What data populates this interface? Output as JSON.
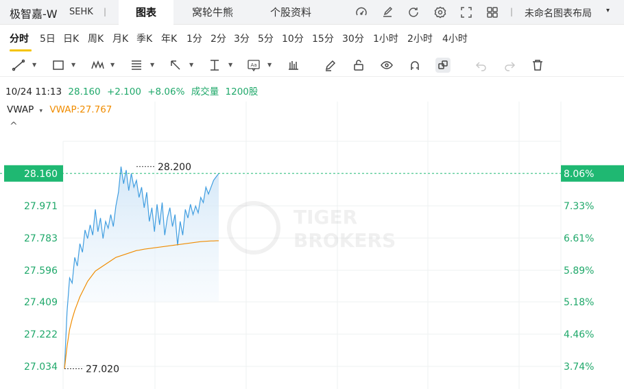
{
  "header": {
    "stock_name": "极智嘉-W",
    "exchange": "SEHK",
    "separator": "|",
    "tabs": [
      {
        "label": "图表",
        "active": true
      },
      {
        "label": "窝轮牛熊",
        "active": false
      },
      {
        "label": "个股资料",
        "active": false
      }
    ],
    "icons": [
      "gauge-icon",
      "edit-icon",
      "refresh-icon",
      "settings-icon",
      "fullscreen-icon",
      "grid-layout-icon"
    ],
    "layout_separator": "|",
    "layout_name": "未命名图表布局",
    "layout_caret": "▾"
  },
  "periods": [
    "分时",
    "5日",
    "日K",
    "周K",
    "月K",
    "季K",
    "年K",
    "1分",
    "2分",
    "3分",
    "5分",
    "10分",
    "15分",
    "30分",
    "1小时",
    "2小时",
    "4小时"
  ],
  "active_period": "分时",
  "toolbar": {
    "tools": [
      "trend-line-icon",
      "rectangle-icon",
      "wave-icon",
      "fibonacci-icon",
      "arrow-icon",
      "vertical-measure-icon",
      "text-note-icon",
      "bar-pattern-icon",
      "pen-icon",
      "lock-icon",
      "eye-icon",
      "magnet-icon",
      "link-icon",
      "undo-icon",
      "redo-icon",
      "trash-icon"
    ]
  },
  "quote": {
    "datetime": "10/24 11:13",
    "price": "28.160",
    "change": "+2.100",
    "change_pct": "+8.06%",
    "volume_label": "成交量",
    "volume": "1200股"
  },
  "indicator": {
    "name": "VWAP",
    "caret": "▾",
    "value_text": "VWAP:27.767",
    "collapse_icon": "^"
  },
  "colors": {
    "green": "#1fa86a",
    "price_line": "#3f9de0",
    "vwap_line": "#f08c00",
    "highlight_bg": "#1fb872"
  },
  "watermark": {
    "line1": "TIGER",
    "line2": "BROKERS"
  },
  "chart_data": {
    "type": "line",
    "y_left_ticks": [
      "27.971",
      "27.783",
      "27.596",
      "27.409",
      "27.222",
      "27.034"
    ],
    "y_right_ticks": [
      "7.33%",
      "6.61%",
      "5.89%",
      "5.18%",
      "4.46%",
      "3.74%"
    ],
    "current_price_label": "28.160",
    "current_pct_label": "8.06%",
    "high_label": "28.200",
    "low_label": "27.020",
    "ylim": [
      27.0,
      28.25
    ],
    "price_series": [
      27.02,
      27.35,
      27.55,
      27.52,
      27.67,
      27.62,
      27.75,
      27.7,
      27.83,
      27.78,
      27.86,
      27.8,
      27.95,
      27.82,
      27.9,
      27.78,
      27.88,
      27.84,
      27.92,
      27.85,
      27.97,
      28.05,
      28.2,
      28.1,
      28.18,
      28.06,
      28.16,
      28.08,
      28.12,
      28.02,
      28.08,
      27.96,
      28.05,
      27.88,
      27.96,
      27.82,
      27.98,
      27.86,
      27.99,
      27.8,
      27.9,
      27.96,
      27.85,
      27.92,
      27.74,
      27.88,
      27.8,
      27.95,
      27.9,
      27.98,
      27.92,
      27.97,
      27.93,
      28.02,
      27.99,
      28.08,
      28.04,
      28.08,
      28.12,
      28.14,
      28.16
    ],
    "vwap_series": [
      27.02,
      27.15,
      27.25,
      27.31,
      27.36,
      27.4,
      27.44,
      27.47,
      27.5,
      27.53,
      27.55,
      27.57,
      27.59,
      27.6,
      27.61,
      27.62,
      27.63,
      27.64,
      27.65,
      27.66,
      27.67,
      27.675,
      27.68,
      27.685,
      27.69,
      27.695,
      27.7,
      27.705,
      27.71,
      27.712,
      27.715,
      27.718,
      27.72,
      27.722,
      27.724,
      27.726,
      27.728,
      27.73,
      27.732,
      27.734,
      27.736,
      27.738,
      27.74,
      27.742,
      27.744,
      27.746,
      27.748,
      27.75,
      27.752,
      27.754,
      27.756,
      27.758,
      27.76,
      27.762,
      27.763,
      27.764,
      27.765,
      27.766,
      27.766,
      27.767,
      27.767
    ]
  }
}
